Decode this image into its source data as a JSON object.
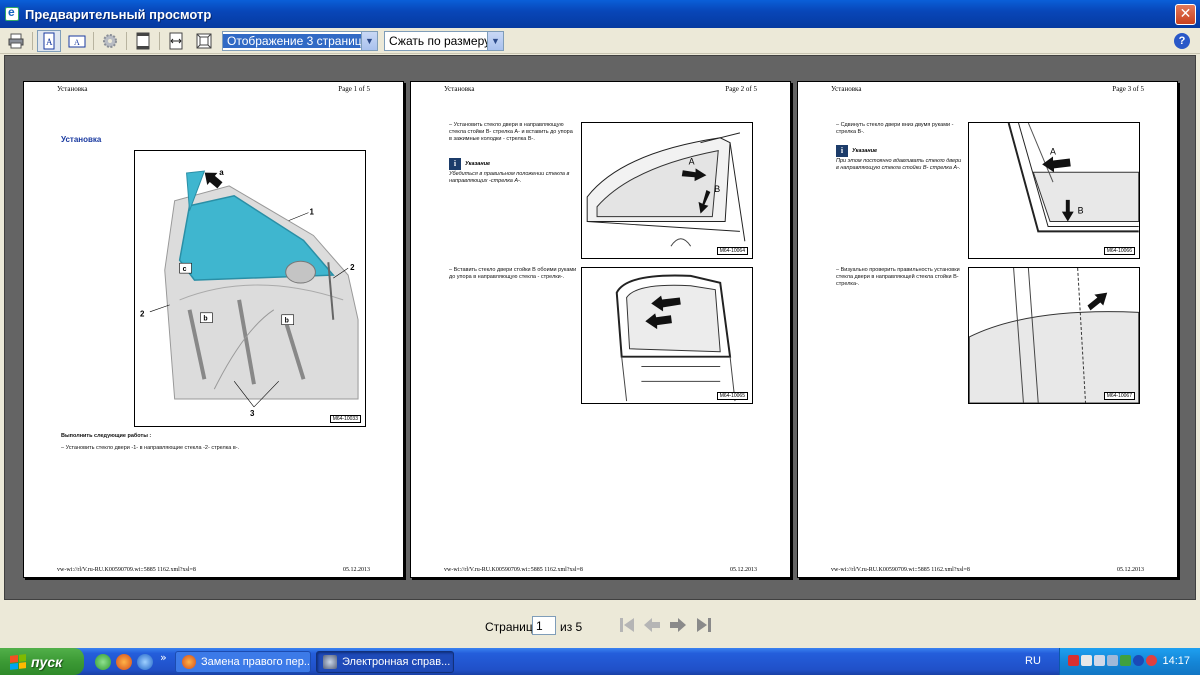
{
  "window": {
    "title": "Предварительный просмотр",
    "close": "✕"
  },
  "toolbar": {
    "view_mode": "Отображение 3 страниц",
    "fit_mode": "Сжать по размеру",
    "help": "?"
  },
  "pages": [
    {
      "header_left": "Установка",
      "header_right": "Page 1 of 5",
      "section_title": "Установка",
      "figure_label": "M64-10033",
      "callouts": [
        "a",
        "1",
        "2",
        "c",
        "2",
        "b",
        "b",
        "3"
      ],
      "work_title": "Выполнить следующие работы :",
      "work_item": "–   Установить стекло двери -1- в направляющие стекла -2- стрелка в-.",
      "footer_left": "vw-wi://rl/V.ru-RU.K00590709.wi::5885 1162.xml?xsl=8",
      "footer_right": "05.12.2013"
    },
    {
      "header_left": "Установка",
      "header_right": "Page 2 of 5",
      "step1": "–   Установить стекло двери в направляющую стекла стойки В- стрелка А- и вставить до упора в зажимные колодки - стрелка В-.",
      "note_label": "Указание",
      "note_text": "Убедиться в правильном положении стекла в направляющих -стрелка А-.",
      "fig1_label": "M64-10064",
      "fig1_callouts": [
        "A",
        "B"
      ],
      "step2": "–   Вставить стекло двери стойки В обоими руками до упора в направляющую стекла - стрелки-.",
      "fig2_label": "M64-10065",
      "footer_left": "vw-wi://rl/V.ru-RU.K00590709.wi::5885 1162.xml?xsl=8",
      "footer_right": "05.12.2013"
    },
    {
      "header_left": "Установка",
      "header_right": "Page 3 of 5",
      "step1": "–   Сдвинуть стекло двери вниз двумя руками - стрелка В-.",
      "note_label": "Указание",
      "note_text": "При этом постоянно вдавливать стекло двери в направляющую стекла стойки В- стрелка А-.",
      "fig1_label": "M64-10066",
      "fig1_callouts": [
        "A",
        "B"
      ],
      "step2": "–   Визуально проверить правильность установки стекла двери в направляющей стекла стойки В- стрелка-.",
      "fig2_label": "M64-10067",
      "footer_left": "vw-wi://rl/V.ru-RU.K00590709.wi::5885 1162.xml?xsl=8",
      "footer_right": "05.12.2013"
    }
  ],
  "nav": {
    "page_label": "Страница",
    "current_page": "1",
    "of_label": "из 5"
  },
  "taskbar": {
    "start": "пуск",
    "chevron": "»",
    "task1": "Замена правого пер...",
    "task2": "Электронная справ...",
    "lang": "RU",
    "clock": "14:17"
  },
  "colors": {
    "titlebar": "#0a5fd8",
    "glass": "#3fb6cf",
    "accent_blue": "#1a3aa0",
    "taskbar": "#245edb"
  }
}
